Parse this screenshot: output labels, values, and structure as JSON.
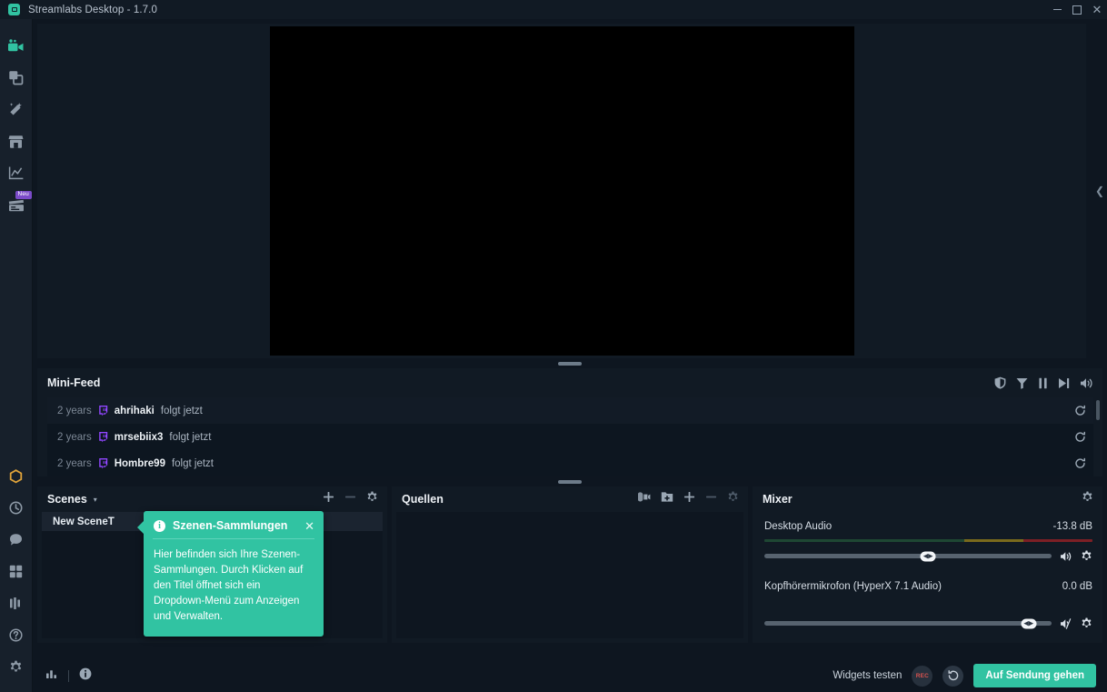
{
  "window": {
    "title": "Streamlabs Desktop - 1.7.0",
    "minimize": "−",
    "maximize": "□",
    "close": "✕"
  },
  "nav": {
    "top_items": [
      {
        "name": "editor",
        "icon": "video-camera-icon",
        "active": true
      },
      {
        "name": "themes",
        "icon": "layers-copy-icon",
        "active": false
      },
      {
        "name": "alertbox",
        "icon": "magic-wand-icon",
        "active": false
      },
      {
        "name": "store",
        "icon": "store-icon",
        "active": false
      },
      {
        "name": "dashboard",
        "icon": "chart-line-icon",
        "active": false
      },
      {
        "name": "highlighter",
        "icon": "clapperboard-icon",
        "active": false,
        "badge": "Neu"
      }
    ],
    "bottom_items": [
      {
        "name": "prime",
        "icon": "hexagon-icon"
      },
      {
        "name": "recent-events",
        "icon": "clock-icon"
      },
      {
        "name": "chat",
        "icon": "chat-bubble-icon"
      },
      {
        "name": "layout-editor",
        "icon": "grid-icon"
      },
      {
        "name": "mixer-panel",
        "icon": "bars-icon"
      },
      {
        "name": "help",
        "icon": "question-icon"
      },
      {
        "name": "settings",
        "icon": "gear-icon"
      }
    ]
  },
  "minifeed": {
    "title": "Mini-Feed",
    "tools": [
      "shield-icon",
      "filter-icon",
      "pause-icon",
      "skip-next-icon",
      "volume-icon"
    ],
    "rows": [
      {
        "age": "2 years",
        "platform": "twitch-icon",
        "user": "ahrihaki",
        "action": "folgt jetzt",
        "replay": "replay-icon"
      },
      {
        "age": "2 years",
        "platform": "twitch-icon",
        "user": "mrsebiix3",
        "action": "folgt jetzt",
        "replay": "replay-icon"
      },
      {
        "age": "2 years",
        "platform": "twitch-icon",
        "user": "Hombre99",
        "action": "folgt jetzt",
        "replay": "replay-icon"
      }
    ]
  },
  "scenes": {
    "title": "Scenes",
    "caret": "▾",
    "tools": [
      "add-icon",
      "remove-icon",
      "settings-icon"
    ],
    "add_label": "+",
    "remove_label": "−",
    "items": [
      {
        "label": "New SceneT"
      }
    ]
  },
  "sources": {
    "title": "Quellen",
    "tools": [
      "webcam-icon",
      "folder-add-icon",
      "add-icon",
      "remove-icon",
      "settings-icon"
    ],
    "add_label": "+",
    "remove_label": "−"
  },
  "mixer": {
    "title": "Mixer",
    "settings_icon": "gear-icon",
    "channels": [
      {
        "name": "Desktop Audio",
        "db": "-13.8 dB",
        "volume_percent": 57,
        "meter": {
          "green_percent": 61,
          "yellow_percent": 18,
          "red_percent": 21
        },
        "muted": false,
        "volume_icon": "speaker-icon",
        "settings_icon": "gear-icon"
      },
      {
        "name": "Kopfhörermikrofon (HyperX 7.1 Audio)",
        "db": "0.0 dB",
        "volume_percent": 92,
        "meter": {
          "green_percent": 0,
          "yellow_percent": 0,
          "red_percent": 0
        },
        "muted": true,
        "volume_icon": "speaker-muted-icon",
        "settings_icon": "gear-icon"
      }
    ]
  },
  "tooltip": {
    "icon": "info-icon",
    "title": "Szenen-Sammlungen",
    "close": "✕",
    "body": "Hier befinden sich Ihre Szenen-Sammlungen. Durch Klicken auf den Titel öffnet sich ein Dropdown-Menü zum Anzeigen und Verwalten."
  },
  "bottombar": {
    "performance_icon": "bar-chart-icon",
    "info_icon": "info-icon",
    "widgets_label": "Widgets testen",
    "record_label": "REC",
    "replay_icon": "replay-buffer-icon",
    "golive_label": "Auf Sendung gehen"
  },
  "colors": {
    "accent": "#31c3a2",
    "twitch": "#9146FF",
    "badge": "#7b4bc9",
    "record": "#d9534f",
    "background": "#0e1620",
    "panel": "#111a24"
  }
}
